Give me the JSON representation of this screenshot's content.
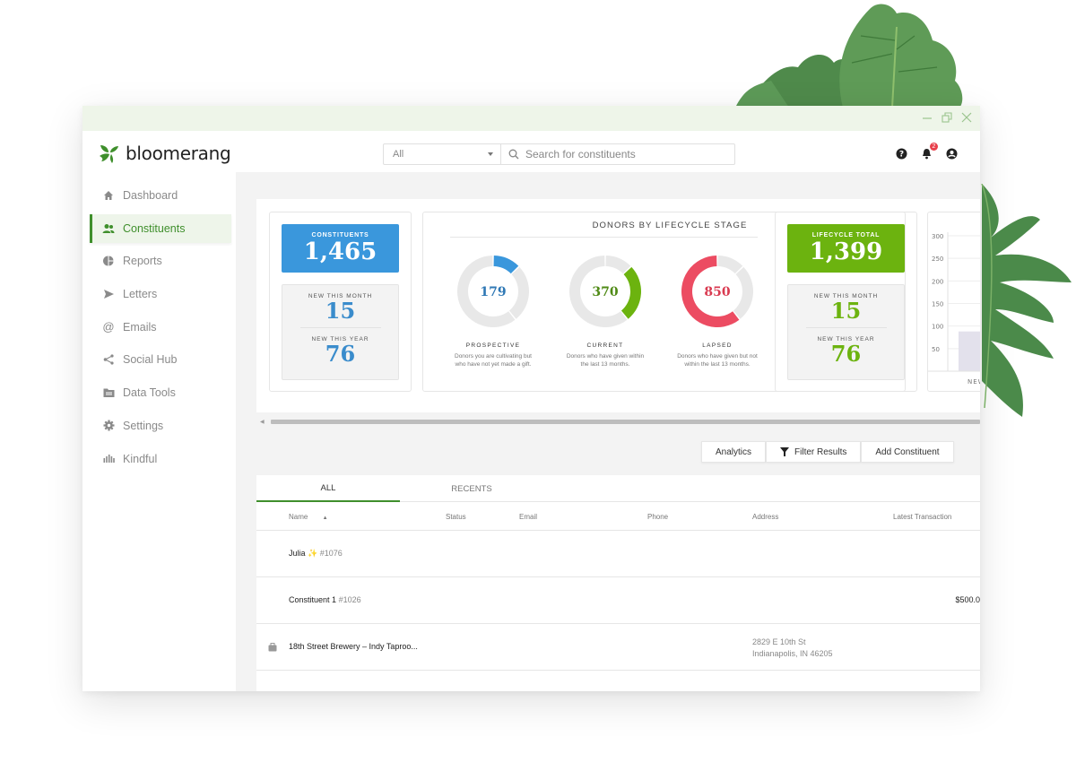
{
  "window": {
    "controls": {
      "minimize": "minimize-icon",
      "restore": "restore-icon",
      "close": "close-icon"
    }
  },
  "brand": {
    "name": "bloomerang",
    "color": "#3f8f2c"
  },
  "search": {
    "scope_value": "All",
    "placeholder": "Search for constituents",
    "value": ""
  },
  "header_icons": {
    "help": "help-icon",
    "notifications": "bell-icon",
    "notification_count": "2",
    "account": "user-icon"
  },
  "sidebar": {
    "items": [
      {
        "label": "Dashboard",
        "icon": "home-icon",
        "active": false
      },
      {
        "label": "Constituents",
        "icon": "users-icon",
        "active": true
      },
      {
        "label": "Reports",
        "icon": "pie-chart-icon",
        "active": false
      },
      {
        "label": "Letters",
        "icon": "send-icon",
        "active": false
      },
      {
        "label": "Emails",
        "icon": "at-icon",
        "active": false
      },
      {
        "label": "Social Hub",
        "icon": "share-icon",
        "active": false
      },
      {
        "label": "Data Tools",
        "icon": "folder-icon",
        "active": false
      },
      {
        "label": "Settings",
        "icon": "gear-icon",
        "active": false
      },
      {
        "label": "Kindful",
        "icon": "kindful-icon",
        "active": false
      }
    ]
  },
  "stats": {
    "constituents": {
      "label": "CONSTITUENTS",
      "value": "1,465",
      "new_month_label": "NEW THIS MONTH",
      "new_month": "15",
      "new_year_label": "NEW THIS YEAR",
      "new_year": "76",
      "color": "#3a97dc"
    },
    "lifecycle": {
      "title": "DONORS BY LIFECYCLE STAGE",
      "stages": [
        {
          "value": 179,
          "label": "PROSPECTIVE",
          "desc1": "Donors you are cultivating but",
          "desc2": "who have not yet made a gift.",
          "color": "#3a97dc"
        },
        {
          "value": 370,
          "label": "CURRENT",
          "desc1": "Donors who have given within",
          "desc2": "the last 13 months.",
          "color": "#6cb30f"
        },
        {
          "value": 850,
          "label": "LAPSED",
          "desc1": "Donors who have given but not",
          "desc2": "within the last 13 months.",
          "color": "#ec4c62"
        }
      ]
    },
    "lifecycle_total": {
      "label": "LIFECYCLE TOTAL",
      "value": "1,399",
      "new_month_label": "NEW THIS MONTH",
      "new_month": "15",
      "new_year_label": "NEW THIS YEAR",
      "new_year": "76",
      "color": "#6cb30f"
    },
    "mini_chart": {
      "ticks": [
        "300",
        "250",
        "200",
        "150",
        "100",
        "50"
      ],
      "x_label_partial": "NEW",
      "bar_value": 88,
      "ymax": 300
    }
  },
  "actions": {
    "analytics": "Analytics",
    "filter": "Filter Results",
    "add": "Add Constituent"
  },
  "table": {
    "tabs": [
      {
        "label": "ALL",
        "active": true
      },
      {
        "label": "RECENTS",
        "active": false
      }
    ],
    "columns": [
      "Name",
      "Status",
      "Email",
      "Phone",
      "Address",
      "Latest Transaction"
    ],
    "rows": [
      {
        "name": "Julia",
        "emoji": "✨",
        "id": "#1076",
        "address1": "",
        "address2": "",
        "transaction": "",
        "org": false
      },
      {
        "name": "Constituent 1",
        "emoji": "",
        "id": "#1026",
        "address1": "",
        "address2": "",
        "transaction": "$500.0",
        "org": false
      },
      {
        "name": "18th Street Brewery – Indy Taproo...",
        "emoji": "",
        "id": "",
        "address1": "2829 E 10th St",
        "address2": "Indianapolis, IN 46205",
        "transaction": "",
        "org": true
      }
    ]
  }
}
